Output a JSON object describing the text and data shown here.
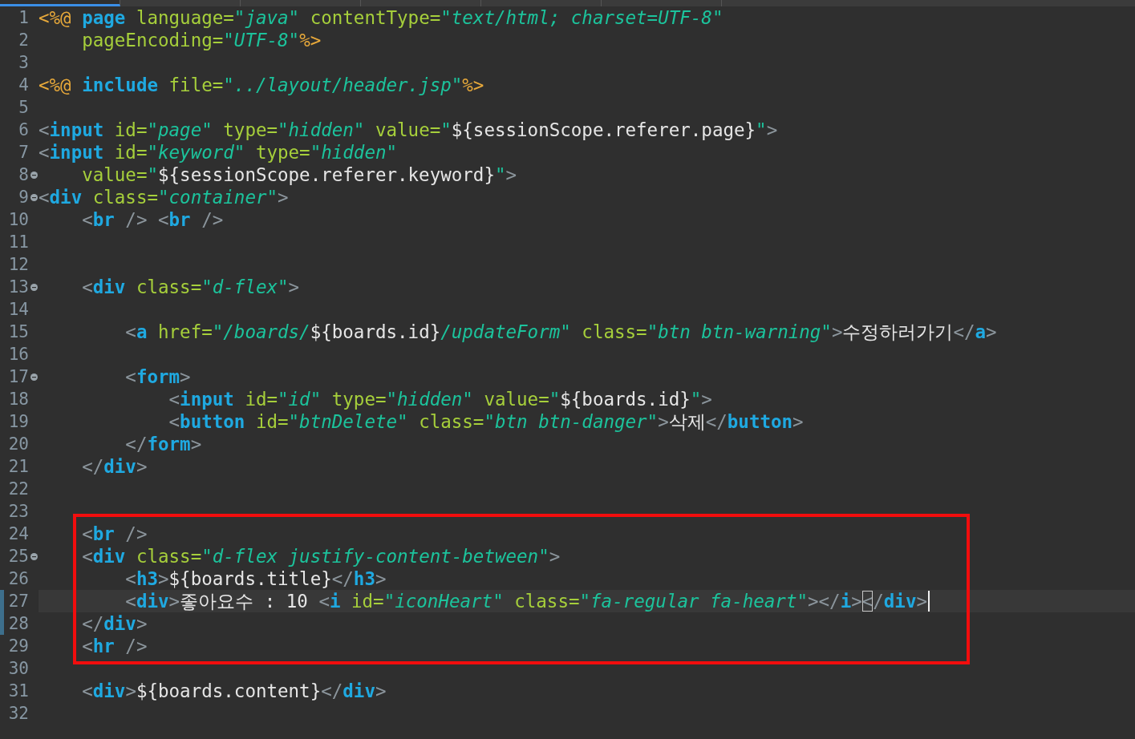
{
  "tabs": [
    {
      "selected": true
    },
    {
      "selected": false
    },
    {
      "selected": false
    },
    {
      "selected": false
    },
    {
      "selected": false
    },
    {
      "selected": false
    }
  ],
  "lines": [
    {
      "n": "1",
      "fold": false,
      "tokens": [
        {
          "kind": "d",
          "text": "<%@ "
        },
        {
          "kind": "t",
          "text": "page"
        },
        {
          "kind": "a",
          "text": " language="
        },
        {
          "kind": "s",
          "text": "\"java\""
        },
        {
          "kind": "a",
          "text": " contentType="
        },
        {
          "kind": "s",
          "text": "\"text/html; charset=UTF-8\""
        }
      ]
    },
    {
      "n": "2",
      "fold": false,
      "tokens": [
        {
          "kind": "a",
          "text": "    pageEncoding="
        },
        {
          "kind": "s",
          "text": "\"UTF-8\""
        },
        {
          "kind": "d",
          "text": "%>"
        }
      ]
    },
    {
      "n": "3",
      "fold": false
    },
    {
      "n": "4",
      "fold": false,
      "tokens": [
        {
          "kind": "d",
          "text": "<%@ "
        },
        {
          "kind": "t",
          "text": "include"
        },
        {
          "kind": "a",
          "text": " file="
        },
        {
          "kind": "s",
          "text": "\"../layout/header.jsp\""
        },
        {
          "kind": "d",
          "text": "%>"
        }
      ]
    },
    {
      "n": "5",
      "fold": false
    },
    {
      "n": "6",
      "fold": false,
      "tokens": [
        {
          "kind": "b",
          "text": "<"
        },
        {
          "kind": "t",
          "text": "input"
        },
        {
          "kind": "a",
          "text": " id="
        },
        {
          "kind": "s",
          "text": "\"page\""
        },
        {
          "kind": "a",
          "text": " type="
        },
        {
          "kind": "s",
          "text": "\"hidden\""
        },
        {
          "kind": "a",
          "text": " value="
        },
        {
          "kind": "s",
          "text": "\""
        },
        {
          "kind": "x",
          "text": "${sessionScope.referer.page}"
        },
        {
          "kind": "s",
          "text": "\""
        },
        {
          "kind": "b",
          "text": ">"
        }
      ]
    },
    {
      "n": "7",
      "fold": false,
      "tokens": [
        {
          "kind": "b",
          "text": "<"
        },
        {
          "kind": "t",
          "text": "input"
        },
        {
          "kind": "a",
          "text": " id="
        },
        {
          "kind": "s",
          "text": "\"keyword\""
        },
        {
          "kind": "a",
          "text": " type="
        },
        {
          "kind": "s",
          "text": "\"hidden\""
        }
      ]
    },
    {
      "n": "8",
      "fold": true,
      "tokens": [
        {
          "kind": "a",
          "text": "    value="
        },
        {
          "kind": "s",
          "text": "\""
        },
        {
          "kind": "x",
          "text": "${sessionScope.referer.keyword}"
        },
        {
          "kind": "s",
          "text": "\""
        },
        {
          "kind": "b",
          "text": ">"
        }
      ]
    },
    {
      "n": "9",
      "fold": true,
      "tokens": [
        {
          "kind": "b",
          "text": "<"
        },
        {
          "kind": "t",
          "text": "div"
        },
        {
          "kind": "a",
          "text": " class="
        },
        {
          "kind": "s",
          "text": "\"container\""
        },
        {
          "kind": "b",
          "text": ">"
        }
      ]
    },
    {
      "n": "10",
      "fold": false,
      "tokens": [
        {
          "kind": "b",
          "text": "    <"
        },
        {
          "kind": "t",
          "text": "br"
        },
        {
          "kind": "b",
          "text": " /> <"
        },
        {
          "kind": "t",
          "text": "br"
        },
        {
          "kind": "b",
          "text": " />"
        }
      ]
    },
    {
      "n": "11",
      "fold": false
    },
    {
      "n": "12",
      "fold": false
    },
    {
      "n": "13",
      "fold": true,
      "tokens": [
        {
          "kind": "b",
          "text": "    <"
        },
        {
          "kind": "t",
          "text": "div"
        },
        {
          "kind": "a",
          "text": " class="
        },
        {
          "kind": "s",
          "text": "\"d-flex\""
        },
        {
          "kind": "b",
          "text": ">"
        }
      ]
    },
    {
      "n": "14",
      "fold": false
    },
    {
      "n": "15",
      "fold": false,
      "tokens": [
        {
          "kind": "b",
          "text": "        <"
        },
        {
          "kind": "t",
          "text": "a"
        },
        {
          "kind": "a",
          "text": " href="
        },
        {
          "kind": "s",
          "text": "\"/boards/"
        },
        {
          "kind": "x",
          "text": "${boards.id}"
        },
        {
          "kind": "s",
          "text": "/updateForm\""
        },
        {
          "kind": "a",
          "text": " class="
        },
        {
          "kind": "s",
          "text": "\"btn btn-warning\""
        },
        {
          "kind": "b",
          "text": ">"
        },
        {
          "kind": "x",
          "text": "수정하러가기"
        },
        {
          "kind": "b",
          "text": "</"
        },
        {
          "kind": "t",
          "text": "a"
        },
        {
          "kind": "b",
          "text": ">"
        }
      ]
    },
    {
      "n": "16",
      "fold": false
    },
    {
      "n": "17",
      "fold": true,
      "tokens": [
        {
          "kind": "b",
          "text": "        <"
        },
        {
          "kind": "t",
          "text": "form"
        },
        {
          "kind": "b",
          "text": ">"
        }
      ]
    },
    {
      "n": "18",
      "fold": false,
      "tokens": [
        {
          "kind": "b",
          "text": "            <"
        },
        {
          "kind": "t",
          "text": "input"
        },
        {
          "kind": "a",
          "text": " id="
        },
        {
          "kind": "s",
          "text": "\"id\""
        },
        {
          "kind": "a",
          "text": " type="
        },
        {
          "kind": "s",
          "text": "\"hidden\""
        },
        {
          "kind": "a",
          "text": " value="
        },
        {
          "kind": "s",
          "text": "\""
        },
        {
          "kind": "x",
          "text": "${boards.id}"
        },
        {
          "kind": "s",
          "text": "\""
        },
        {
          "kind": "b",
          "text": ">"
        }
      ]
    },
    {
      "n": "19",
      "fold": false,
      "tokens": [
        {
          "kind": "b",
          "text": "            <"
        },
        {
          "kind": "t",
          "text": "button"
        },
        {
          "kind": "a",
          "text": " id="
        },
        {
          "kind": "s",
          "text": "\"btnDelete\""
        },
        {
          "kind": "a",
          "text": " class="
        },
        {
          "kind": "s",
          "text": "\"btn btn-danger\""
        },
        {
          "kind": "b",
          "text": ">"
        },
        {
          "kind": "x",
          "text": "삭제"
        },
        {
          "kind": "b",
          "text": "</"
        },
        {
          "kind": "t",
          "text": "button"
        },
        {
          "kind": "b",
          "text": ">"
        }
      ]
    },
    {
      "n": "20",
      "fold": false,
      "tokens": [
        {
          "kind": "b",
          "text": "        </"
        },
        {
          "kind": "t",
          "text": "form"
        },
        {
          "kind": "b",
          "text": ">"
        }
      ]
    },
    {
      "n": "21",
      "fold": false,
      "tokens": [
        {
          "kind": "b",
          "text": "    </"
        },
        {
          "kind": "t",
          "text": "div"
        },
        {
          "kind": "b",
          "text": ">"
        }
      ]
    },
    {
      "n": "22",
      "fold": false
    },
    {
      "n": "23",
      "fold": false
    },
    {
      "n": "24",
      "fold": false,
      "tokens": [
        {
          "kind": "b",
          "text": "    <"
        },
        {
          "kind": "t",
          "text": "br"
        },
        {
          "kind": "b",
          "text": " />"
        }
      ]
    },
    {
      "n": "25",
      "fold": true,
      "tokens": [
        {
          "kind": "b",
          "text": "    <"
        },
        {
          "kind": "t",
          "text": "div"
        },
        {
          "kind": "a",
          "text": " class="
        },
        {
          "kind": "s",
          "text": "\"d-flex justify-content-between\""
        },
        {
          "kind": "b",
          "text": ">"
        }
      ]
    },
    {
      "n": "26",
      "fold": false,
      "tokens": [
        {
          "kind": "b",
          "text": "        <"
        },
        {
          "kind": "t",
          "text": "h3"
        },
        {
          "kind": "b",
          "text": ">"
        },
        {
          "kind": "x",
          "text": "${boards.title}"
        },
        {
          "kind": "b",
          "text": "</"
        },
        {
          "kind": "t",
          "text": "h3"
        },
        {
          "kind": "b",
          "text": ">"
        }
      ]
    },
    {
      "n": "27",
      "fold": false,
      "current": true,
      "cursor": true,
      "modified": true,
      "tokens": [
        {
          "kind": "b",
          "text": "        <"
        },
        {
          "kind": "t",
          "text": "div"
        },
        {
          "kind": "b",
          "text": ">"
        },
        {
          "kind": "x",
          "text": "좋아요수 : 10 "
        },
        {
          "kind": "b",
          "text": "<"
        },
        {
          "kind": "t",
          "text": "i"
        },
        {
          "kind": "a",
          "text": " id="
        },
        {
          "kind": "s",
          "text": "\"iconHeart\""
        },
        {
          "kind": "a",
          "text": " class="
        },
        {
          "kind": "s",
          "text": "\"fa-regular fa-heart\""
        },
        {
          "kind": "b",
          "text": "></"
        },
        {
          "kind": "t",
          "text": "i"
        },
        {
          "kind": "b",
          "text": ">"
        },
        {
          "kind": "m",
          "text": "<"
        },
        {
          "kind": "b",
          "text": "/"
        },
        {
          "kind": "t",
          "text": "div"
        },
        {
          "kind": "b",
          "text": ">"
        }
      ]
    },
    {
      "n": "28",
      "fold": false,
      "modified": true,
      "tokens": [
        {
          "kind": "b",
          "text": "    </"
        },
        {
          "kind": "t",
          "text": "div"
        },
        {
          "kind": "b",
          "text": ">"
        }
      ]
    },
    {
      "n": "29",
      "fold": false,
      "tokens": [
        {
          "kind": "b",
          "text": "    <"
        },
        {
          "kind": "t",
          "text": "hr"
        },
        {
          "kind": "b",
          "text": " />"
        }
      ]
    },
    {
      "n": "30",
      "fold": false
    },
    {
      "n": "31",
      "fold": false,
      "tokens": [
        {
          "kind": "b",
          "text": "    <"
        },
        {
          "kind": "t",
          "text": "div"
        },
        {
          "kind": "b",
          "text": ">"
        },
        {
          "kind": "x",
          "text": "${boards.content}"
        },
        {
          "kind": "b",
          "text": "</"
        },
        {
          "kind": "t",
          "text": "div"
        },
        {
          "kind": "b",
          "text": ">"
        }
      ]
    },
    {
      "n": "32",
      "fold": false
    }
  ]
}
